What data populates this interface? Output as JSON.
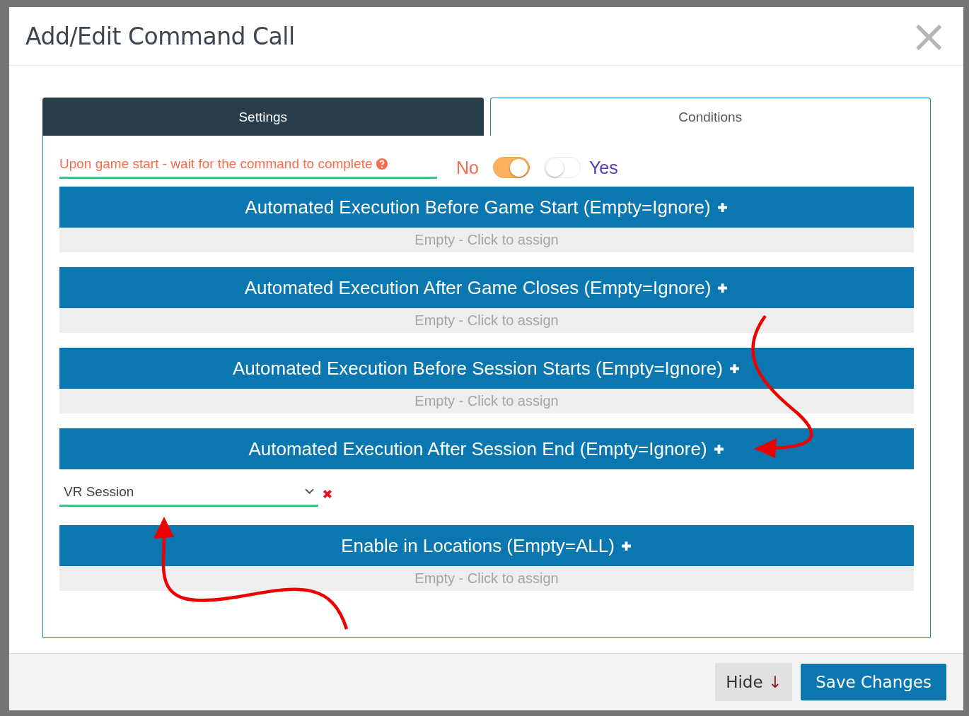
{
  "dialog": {
    "title": "Add/Edit Command Call",
    "close": "×"
  },
  "tabs": [
    {
      "label": "Settings",
      "selected": true
    },
    {
      "label": "Conditions",
      "selected": false
    }
  ],
  "wait_setting": {
    "label": "Upon game start - wait for the command to complete",
    "off_label": "No",
    "on_label": "Yes",
    "toggles": [
      {
        "on": true
      },
      {
        "on": false
      }
    ]
  },
  "sections": [
    {
      "title": "Automated Execution Before Game Start (Empty=Ignore)",
      "kind": "empty",
      "empty_text": "Empty - Click to assign"
    },
    {
      "title": "Automated Execution After Game Closes (Empty=Ignore)",
      "kind": "empty",
      "empty_text": "Empty - Click to assign"
    },
    {
      "title": "Automated Execution Before Session Starts (Empty=Ignore)",
      "kind": "empty",
      "empty_text": "Empty - Click to assign"
    },
    {
      "title": "Automated Execution After Session End (Empty=Ignore)",
      "kind": "items",
      "items": [
        {
          "value": "VR Session"
        }
      ]
    },
    {
      "title": "Enable in Locations (Empty=ALL)",
      "kind": "empty",
      "empty_text": "Empty - Click to assign"
    }
  ],
  "footer": {
    "hide_label": "Hide",
    "hide_arrow": "↓",
    "save_label": "Save Changes"
  }
}
